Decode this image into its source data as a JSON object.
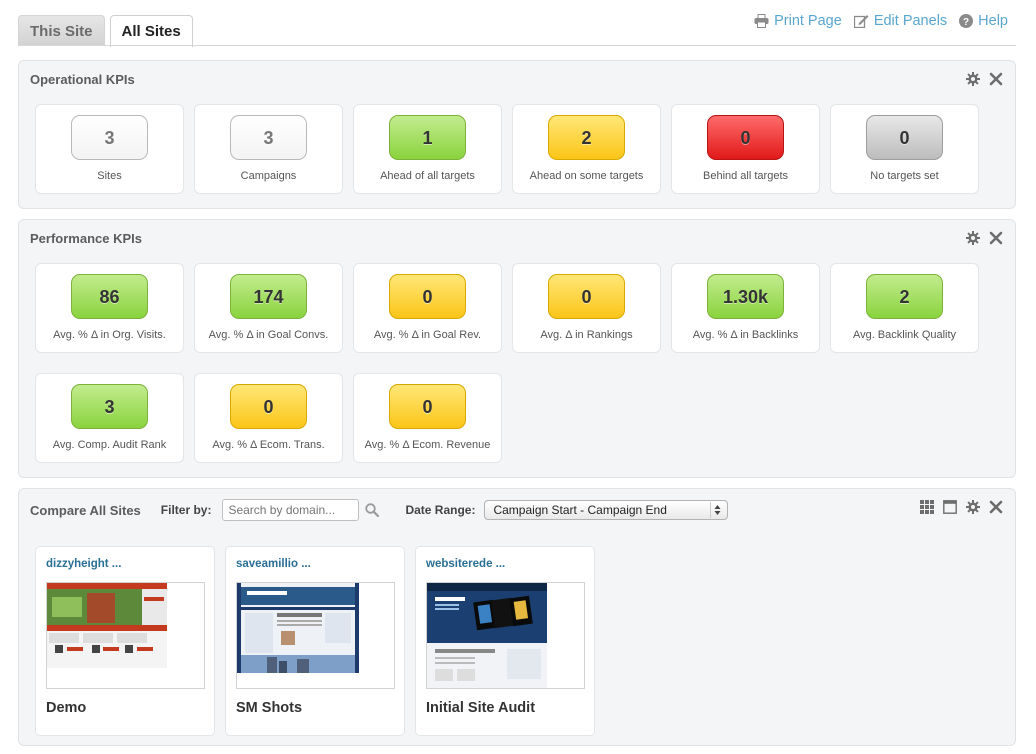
{
  "tabs": [
    {
      "label": "This Site",
      "active": false
    },
    {
      "label": "All Sites",
      "active": true
    }
  ],
  "toplinks": {
    "print": "Print Page",
    "edit": "Edit Panels",
    "help": "Help"
  },
  "colors": {
    "link": "#5aa6cf",
    "green": "#8ad33e",
    "yellow": "#fbc518",
    "red": "#e11919",
    "gray": "#bdbdbd"
  },
  "operational": {
    "title": "Operational KPIs",
    "cards": [
      {
        "value": "3",
        "label": "Sites",
        "color": "white"
      },
      {
        "value": "3",
        "label": "Campaigns",
        "color": "white"
      },
      {
        "value": "1",
        "label": "Ahead of all targets",
        "color": "green"
      },
      {
        "value": "2",
        "label": "Ahead on some targets",
        "color": "yellow"
      },
      {
        "value": "0",
        "label": "Behind all targets",
        "color": "red"
      },
      {
        "value": "0",
        "label": "No targets set",
        "color": "gray"
      }
    ]
  },
  "performance": {
    "title": "Performance KPIs",
    "cards": [
      {
        "value": "86",
        "label": "Avg. % Δ in Org. Visits.",
        "color": "green"
      },
      {
        "value": "174",
        "label": "Avg. % Δ in Goal Convs.",
        "color": "green"
      },
      {
        "value": "0",
        "label": "Avg. % Δ in Goal Rev.",
        "color": "yellow"
      },
      {
        "value": "0",
        "label": "Avg. Δ in Rankings",
        "color": "yellow"
      },
      {
        "value": "1.30k",
        "label": "Avg. % Δ in Backlinks",
        "color": "green"
      },
      {
        "value": "2",
        "label": "Avg. Backlink Quality",
        "color": "green"
      },
      {
        "value": "3",
        "label": "Avg. Comp. Audit Rank",
        "color": "green"
      },
      {
        "value": "0",
        "label": "Avg. % Δ Ecom. Trans.",
        "color": "yellow"
      },
      {
        "value": "0",
        "label": "Avg. % Δ Ecom. Revenue",
        "color": "yellow"
      }
    ]
  },
  "compare": {
    "title": "Compare All Sites",
    "filter_label": "Filter by:",
    "search_placeholder": "Search by domain...",
    "date_label": "Date Range:",
    "date_value": "Campaign Start - Campaign End",
    "sites": [
      {
        "domain": "dizzyheight ...",
        "name": "Demo"
      },
      {
        "domain": "saveamillio ...",
        "name": "SM Shots"
      },
      {
        "domain": "websiterede ...",
        "name": "Initial Site Audit"
      }
    ]
  }
}
